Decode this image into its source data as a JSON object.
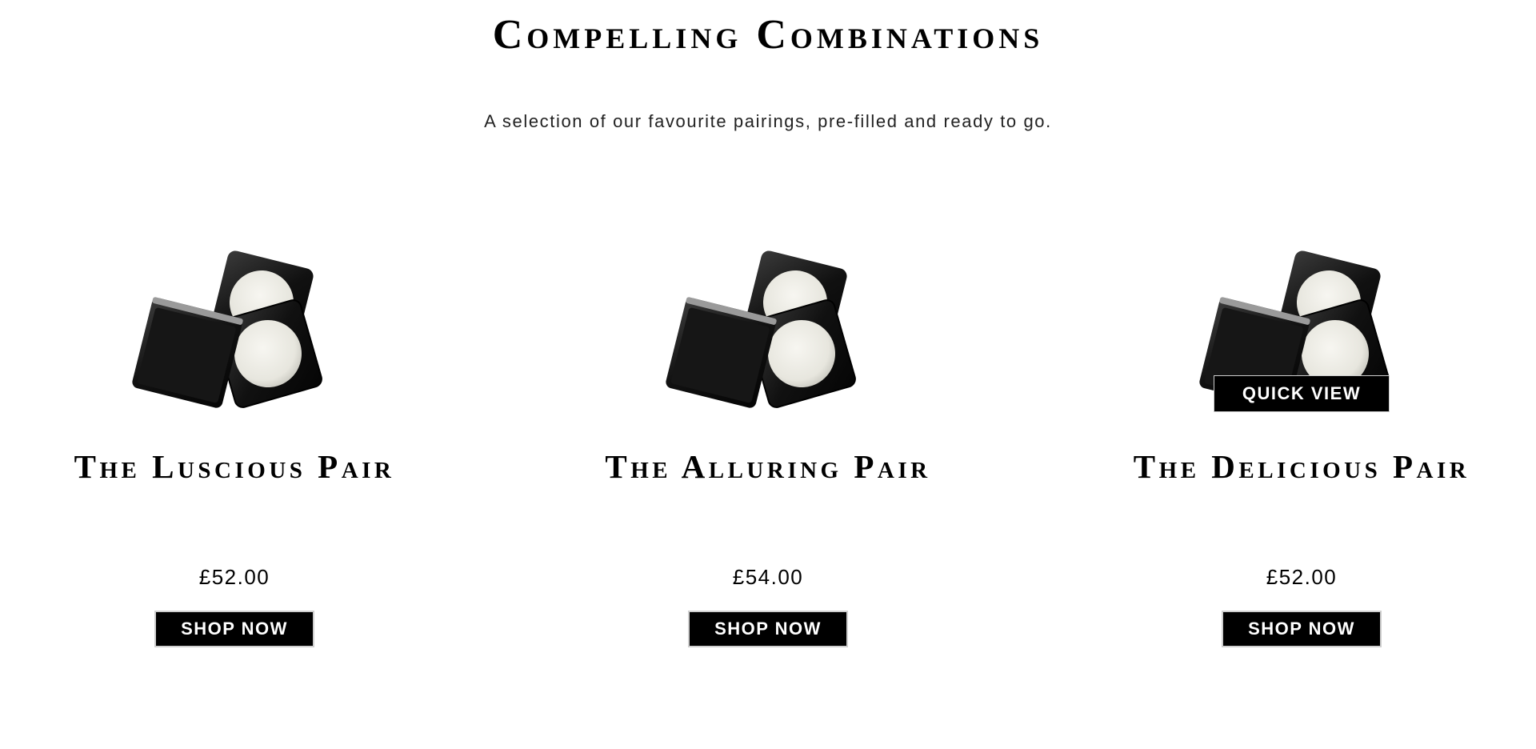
{
  "section": {
    "title": "Compelling Combinations",
    "subtitle": "A selection of our favourite pairings, pre-filled and ready to go."
  },
  "products": [
    {
      "name": "The Luscious Pair",
      "price": "£52.00",
      "button_label": "SHOP NOW",
      "image_icon": "compact-pair-image"
    },
    {
      "name": "The Alluring Pair",
      "price": "£54.00",
      "button_label": "SHOP NOW",
      "image_icon": "compact-pair-image"
    },
    {
      "name": "The Delicious Pair",
      "price": "£52.00",
      "button_label": "SHOP NOW",
      "image_icon": "compact-pair-image",
      "quick_view_label": "QUICK VIEW"
    }
  ],
  "colors": {
    "button_bg": "#000000",
    "button_text": "#ffffff",
    "compact_case": "#1a1a1a",
    "balm_cream": "#ecebe4"
  }
}
